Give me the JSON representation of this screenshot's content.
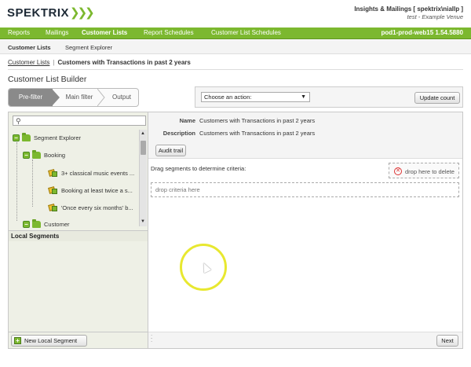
{
  "header": {
    "logo_text": "SPEKTRIX",
    "user_line": "Insights & Mailings [ spektrix\\niallp ]",
    "venue_line": "test - Example Venue"
  },
  "nav": {
    "items": [
      {
        "label": "Reports",
        "active": false
      },
      {
        "label": "Mailings",
        "active": false
      },
      {
        "label": "Customer Lists",
        "active": true
      },
      {
        "label": "Report Schedules",
        "active": false
      },
      {
        "label": "Customer List Schedules",
        "active": false
      }
    ],
    "server": "pod1-prod-web15 1.54.5880"
  },
  "subnav": {
    "items": [
      {
        "label": "Customer Lists",
        "active": true
      },
      {
        "label": "Segment Explorer",
        "active": false
      }
    ]
  },
  "breadcrumb": {
    "link": "Customer Lists",
    "separator": "|",
    "current": "Customers with Transactions in past 2 years"
  },
  "page_title": "Customer List Builder",
  "steps": [
    {
      "label": "Pre-filter",
      "active": true
    },
    {
      "label": "Main filter",
      "active": false
    },
    {
      "label": "Output",
      "active": false
    }
  ],
  "action_bar": {
    "select_value": "Choose an action:",
    "update_button": "Update count"
  },
  "left_panel": {
    "search_placeholder": "",
    "tree": {
      "root": "Segment Explorer",
      "booking_folder": "Booking",
      "booking_items": [
        "3+ classical music events ...",
        "Booking at least twice a s...",
        "'Once every six months' b..."
      ],
      "customer_folder": "Customer"
    },
    "local_segments_title": "Local Segments",
    "new_segment_button": "New Local Segment"
  },
  "right_panel": {
    "name_label": "Name",
    "name_value": "Customers with Transactions in past 2 years",
    "description_label": "Description",
    "description_value": "Customers with Transactions in past 2 years",
    "audit_button": "Audit trail",
    "drag_instructions": "Drag segments to determine criteria:",
    "delete_zone": "drop here to delete",
    "drop_zone": "drop criteria here",
    "next_button": "Next"
  },
  "colors": {
    "brand_green": "#7cb82f",
    "panel_bg": "#eef0e6",
    "cursor_highlight": "#e8e830"
  }
}
